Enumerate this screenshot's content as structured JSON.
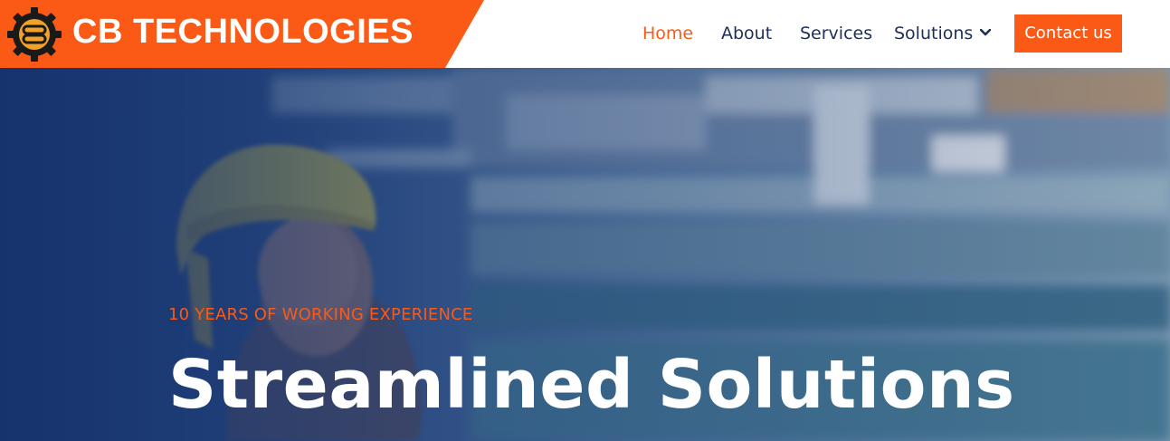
{
  "brand": {
    "name": "CB TECHNOLOGIES",
    "logo_icon": "gear-cb-logo-icon",
    "color": "#fa5a16"
  },
  "nav": {
    "items": [
      {
        "label": "Home",
        "active": true
      },
      {
        "label": "About",
        "active": false
      },
      {
        "label": "Services",
        "active": false
      },
      {
        "label": "Solutions",
        "active": false,
        "icon": "chevron-down-icon"
      }
    ],
    "cta_label": "Contact us"
  },
  "hero": {
    "eyebrow": "10 YEARS OF WORKING EXPERIENCE",
    "headline": "Streamlined Solutions",
    "background_image": "worker-in-hard-hat-factory-photo"
  },
  "colors": {
    "accent": "#fa5a16",
    "nav_text": "#1f2f57",
    "hero_overlay": "#17336e"
  }
}
